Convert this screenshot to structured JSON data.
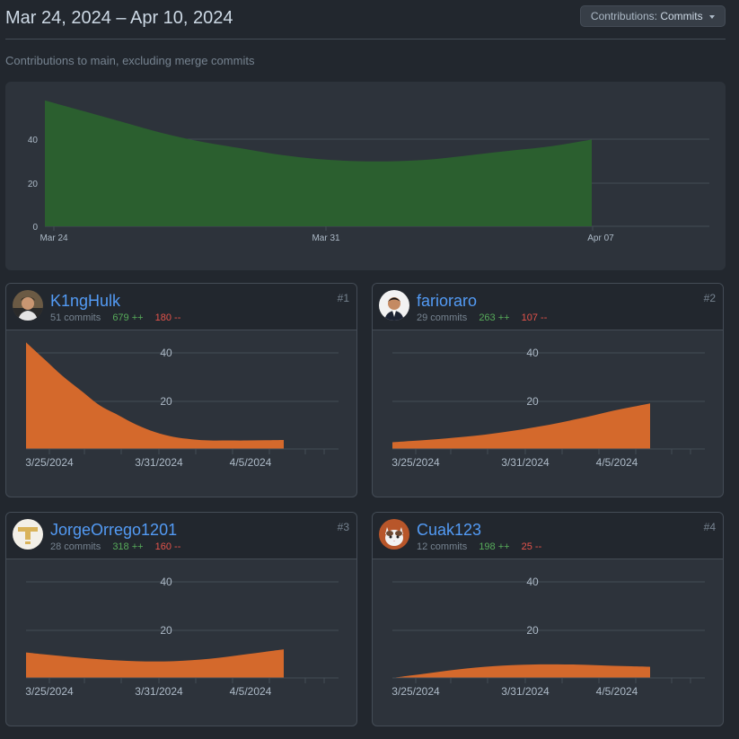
{
  "header": {
    "date_range": "Mar 24, 2024 – Apr 10, 2024",
    "contributions_label": "Contributions:",
    "contributions_value": "Commits"
  },
  "subtitle": "Contributions to main, excluding merge commits",
  "chart_data": [
    {
      "type": "area",
      "x": [
        "Mar 24",
        "Mar 25",
        "Mar 26",
        "Mar 27",
        "Mar 28",
        "Mar 29",
        "Mar 30",
        "Mar 31",
        "Apr 1",
        "Apr 2",
        "Apr 3",
        "Apr 4",
        "Apr 5",
        "Apr 6",
        "Apr 7"
      ],
      "values": [
        58,
        53,
        48,
        43,
        39,
        36,
        33,
        31,
        30,
        30,
        31,
        33,
        35,
        37,
        40
      ],
      "xticks": [
        "Mar 24",
        "Mar 31",
        "Apr 07"
      ],
      "yticks": [
        0,
        20,
        40
      ],
      "ylim": [
        0,
        60
      ],
      "color": "#2b5f2f",
      "grid": true
    },
    {
      "type": "area",
      "x": [
        "3/24",
        "3/25",
        "3/26",
        "3/27",
        "3/28",
        "3/29",
        "3/30",
        "3/31",
        "4/1",
        "4/2",
        "4/3",
        "4/4",
        "4/5",
        "4/6",
        "4/7"
      ],
      "values": [
        44,
        37,
        30,
        24,
        18,
        14,
        10,
        7,
        5,
        4,
        3.5,
        3.5,
        3.5,
        3.6,
        3.7
      ],
      "xticks": [
        "3/25/2024",
        "3/31/2024",
        "4/5/2024"
      ],
      "yticks": [
        20,
        40
      ],
      "ylim": [
        0,
        50
      ],
      "color": "#d4692c"
    },
    {
      "type": "area",
      "x": [
        "3/24",
        "3/25",
        "3/26",
        "3/27",
        "3/28",
        "3/29",
        "3/30",
        "3/31",
        "4/1",
        "4/2",
        "4/3",
        "4/4",
        "4/5",
        "4/6",
        "4/7"
      ],
      "values": [
        2.8,
        3.3,
        3.8,
        4.4,
        5.1,
        5.9,
        6.9,
        8,
        9.3,
        10.7,
        12.3,
        14,
        15.8,
        17.3,
        18.8
      ],
      "xticks": [
        "3/25/2024",
        "3/31/2024",
        "4/5/2024"
      ],
      "yticks": [
        20,
        40
      ],
      "ylim": [
        0,
        50
      ],
      "color": "#d4692c"
    },
    {
      "type": "area",
      "x": [
        "3/24",
        "3/25",
        "3/26",
        "3/27",
        "3/28",
        "3/29",
        "3/30",
        "3/31",
        "4/1",
        "4/2",
        "4/3",
        "4/4",
        "4/5",
        "4/6",
        "4/7"
      ],
      "values": [
        10.5,
        9.7,
        9,
        8.3,
        7.7,
        7.2,
        6.9,
        6.8,
        6.9,
        7.3,
        7.9,
        8.8,
        9.8,
        10.8,
        11.8
      ],
      "xticks": [
        "3/25/2024",
        "3/31/2024",
        "4/5/2024"
      ],
      "yticks": [
        20,
        40
      ],
      "ylim": [
        0,
        50
      ],
      "color": "#d4692c"
    },
    {
      "type": "area",
      "x": [
        "3/24",
        "3/25",
        "3/26",
        "3/27",
        "3/28",
        "3/29",
        "3/30",
        "3/31",
        "4/1",
        "4/2",
        "4/3",
        "4/4",
        "4/5",
        "4/6",
        "4/7"
      ],
      "values": [
        0,
        1,
        2,
        3,
        3.9,
        4.6,
        5.1,
        5.4,
        5.6,
        5.6,
        5.5,
        5.3,
        5,
        4.8,
        4.6
      ],
      "xticks": [
        "3/25/2024",
        "3/31/2024",
        "4/5/2024"
      ],
      "yticks": [
        20,
        40
      ],
      "ylim": [
        0,
        50
      ],
      "color": "#d4692c"
    }
  ],
  "contributors": [
    {
      "name": "K1ngHulk",
      "commits": "51 commits",
      "additions": "679 ++",
      "deletions": "180 --",
      "rank": "#1",
      "avatar": "avatar-photo-icon"
    },
    {
      "name": "farioraro",
      "commits": "29 commits",
      "additions": "263 ++",
      "deletions": "107 --",
      "rank": "#2",
      "avatar": "avatar-photo-icon"
    },
    {
      "name": "JorgeOrrego1201",
      "commits": "28 commits",
      "additions": "318 ++",
      "deletions": "160 --",
      "rank": "#3",
      "avatar": "identicon-icon"
    },
    {
      "name": "Cuak123",
      "commits": "12 commits",
      "additions": "198 ++",
      "deletions": "25 --",
      "rank": "#4",
      "avatar": "cat-avatar-icon"
    }
  ]
}
